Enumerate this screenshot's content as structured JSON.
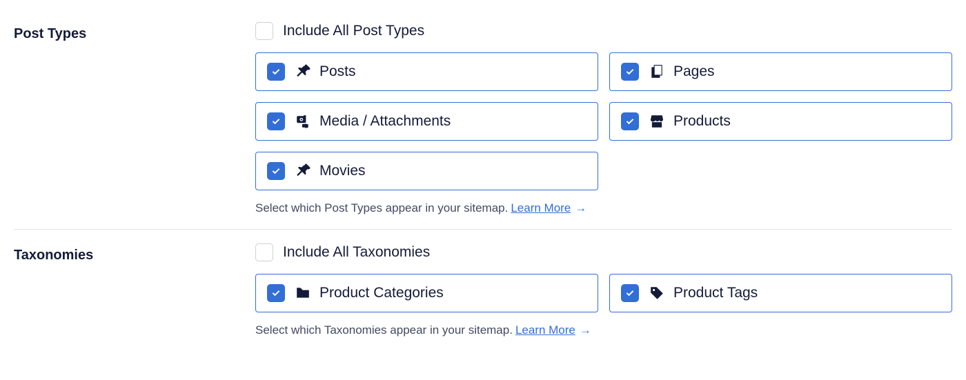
{
  "sections": {
    "post_types": {
      "title": "Post Types",
      "include_all_label": "Include All Post Types",
      "include_all_checked": false,
      "items": [
        {
          "label": "Posts",
          "icon": "pin",
          "checked": true
        },
        {
          "label": "Pages",
          "icon": "pages",
          "checked": true
        },
        {
          "label": "Media / Attachments",
          "icon": "media",
          "checked": true
        },
        {
          "label": "Products",
          "icon": "store",
          "checked": true
        },
        {
          "label": "Movies",
          "icon": "pin",
          "checked": true
        }
      ],
      "helper_text": "Select which Post Types appear in your sitemap.",
      "learn_more": "Learn More"
    },
    "taxonomies": {
      "title": "Taxonomies",
      "include_all_label": "Include All Taxonomies",
      "include_all_checked": false,
      "items": [
        {
          "label": "Product Categories",
          "icon": "folder",
          "checked": true
        },
        {
          "label": "Product Tags",
          "icon": "tag",
          "checked": true
        }
      ],
      "helper_text": "Select which Taxonomies appear in your sitemap.",
      "learn_more": "Learn More"
    }
  },
  "colors": {
    "accent": "#326ED6",
    "text": "#141B38",
    "muted": "#434960",
    "border": "#e5e5e5"
  }
}
